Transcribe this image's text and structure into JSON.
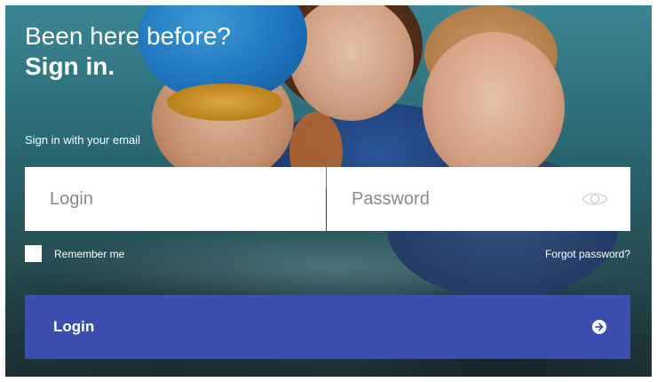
{
  "heading": {
    "line1": "Been here before?",
    "line2": "Sign in."
  },
  "subheading": "Sign in with your email",
  "fields": {
    "login_placeholder": "Login",
    "password_placeholder": "Password"
  },
  "remember_label": "Remember me",
  "remember_checked": false,
  "forgot_label": "Forgot password?",
  "submit": {
    "label": "Login",
    "icon": "arrow-right-circle-icon"
  },
  "icons": {
    "password_toggle": "eye-icon"
  },
  "colors": {
    "button": "#3d4fae",
    "field_bg": "#ffffff",
    "placeholder": "#8a8a8a",
    "text_on_photo": "#ffffff"
  }
}
